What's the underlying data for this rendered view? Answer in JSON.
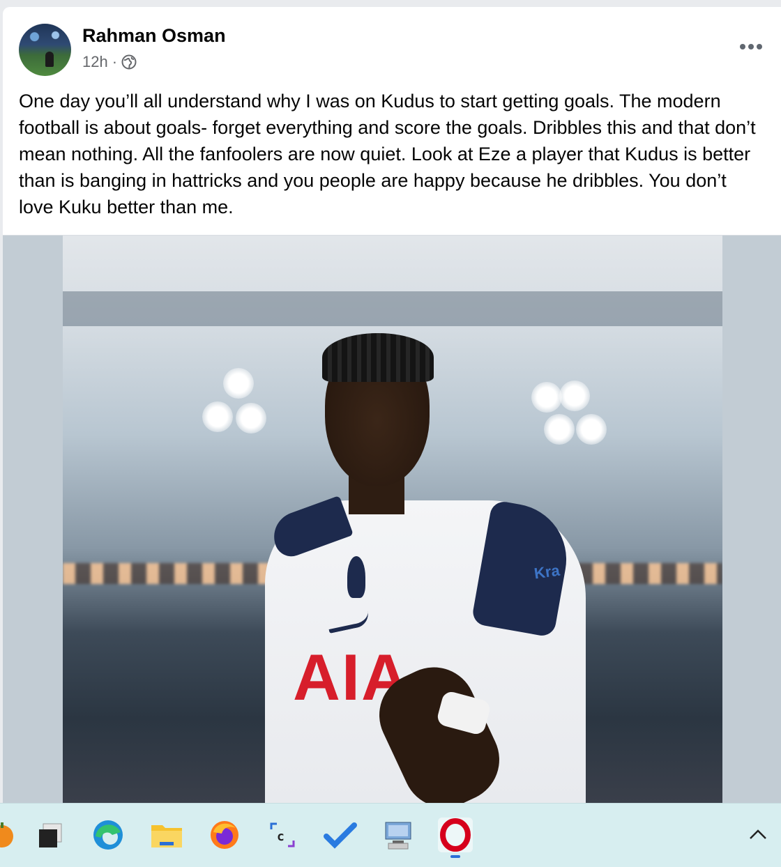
{
  "post": {
    "author": "Rahman Osman",
    "time": "12h",
    "separator": "·",
    "privacy_icon": "globe-icon",
    "menu_icon": "more-horizontal-icon",
    "text": "One day you’ll all understand why I was on Kudus to start getting goals. The modern football is about goals- forget everything and score the goals. Dribbles this and that don’t mean nothing. All the fanfoolers are now quiet. Look at Eze a player that Kudus is better than is banging in hattricks and you people are happy because he dribbles. You don’t love Kuku better than me.",
    "photo": {
      "jersey_sponsor": "AIA",
      "sleeve_text": "Kra"
    }
  },
  "taskbar": {
    "items": [
      {
        "icon": "pumpkin-app-icon"
      },
      {
        "icon": "task-view-icon"
      },
      {
        "icon": "edge-browser-icon"
      },
      {
        "icon": "file-explorer-icon"
      },
      {
        "icon": "firefox-icon"
      },
      {
        "icon": "snipping-tool-icon"
      },
      {
        "icon": "todo-check-icon"
      },
      {
        "icon": "remote-desktop-icon"
      },
      {
        "icon": "opera-browser-icon",
        "active": true
      }
    ],
    "tray_icon": "chevron-up-icon"
  },
  "colors": {
    "author_text": "#050505",
    "meta_text": "#65676b",
    "taskbar_bg": "#d7eef0",
    "opera_red": "#d6001c",
    "sponsor_red": "#d71e2b",
    "kit_navy": "#1d2a4d"
  }
}
